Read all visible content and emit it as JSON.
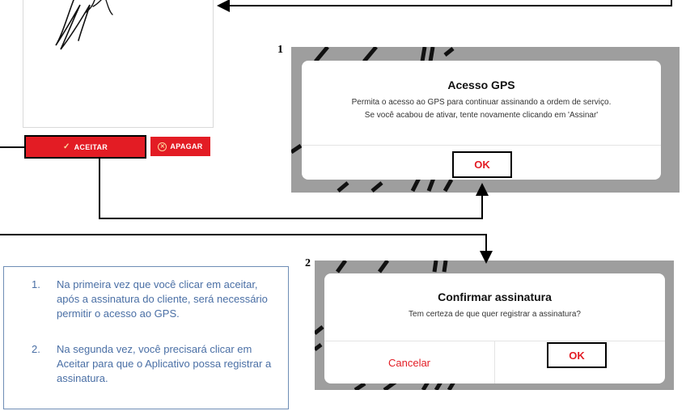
{
  "signature_panel": {
    "accept_button": {
      "label": "ACEITAR",
      "icon": "check-icon"
    },
    "erase_button": {
      "label": "APAGAR",
      "icon": "circle-x-icon"
    },
    "brand_color": "#e31c24"
  },
  "step1": {
    "number": "1",
    "dialog": {
      "title": "Acesso GPS",
      "message_line1": "Permita o acesso ao GPS para continuar assinando a ordem de serviço.",
      "message_line2": "Se você acabou de ativar, tente novamente clicando em 'Assinar'",
      "ok_label": "OK"
    }
  },
  "step2": {
    "number": "2",
    "dialog": {
      "title": "Confirmar assinatura",
      "message": "Tem certeza de que quer registrar a assinatura?",
      "cancel_label": "Cancelar",
      "ok_label": "OK"
    }
  },
  "instructions": {
    "items": [
      {
        "number": "1.",
        "text": "Na primeira vez que você clicar em aceitar, após a assinatura do cliente, será necessário permitir o acesso ao GPS."
      },
      {
        "number": "2.",
        "text": "Na segunda vez, você precisará clicar em Aceitar para que o Aplicativo possa registrar a assinatura."
      }
    ],
    "text_color": "#4a6fa5",
    "border_color": "#6e8db5"
  }
}
